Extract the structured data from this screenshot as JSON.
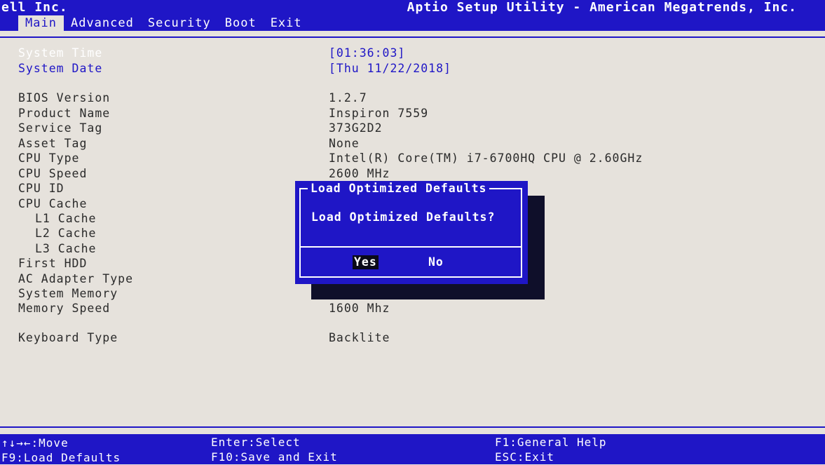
{
  "header": {
    "vendor": "ell Inc.",
    "utility": "Aptio Setup Utility - American Megatrends, Inc.",
    "tabs": [
      {
        "label": "Main",
        "active": true
      },
      {
        "label": "Advanced",
        "active": false
      },
      {
        "label": "Security",
        "active": false
      },
      {
        "label": "Boot",
        "active": false
      },
      {
        "label": "Exit",
        "active": false
      }
    ]
  },
  "main": {
    "system_time": {
      "label": "System Time",
      "value": "[01:36:03]"
    },
    "system_date": {
      "label": "System Date",
      "value": "[Thu 11/22/2018]"
    },
    "info": [
      {
        "label": "BIOS Version",
        "value": "1.2.7"
      },
      {
        "label": "Product Name",
        "value": "Inspiron 7559"
      },
      {
        "label": "Service Tag",
        "value": "373G2D2"
      },
      {
        "label": "Asset Tag",
        "value": "None"
      },
      {
        "label": "CPU Type",
        "value": "Intel(R) Core(TM) i7-6700HQ CPU @ 2.60GHz"
      },
      {
        "label": "CPU Speed",
        "value": "2600 MHz"
      },
      {
        "label": "CPU ID",
        "value": ""
      },
      {
        "label": "CPU Cache",
        "value": ""
      },
      {
        "label": "L1 Cache",
        "value": ""
      },
      {
        "label": "L2 Cache",
        "value": ""
      },
      {
        "label": "L3 Cache",
        "value": ""
      },
      {
        "label": "First HDD",
        "value": ""
      },
      {
        "label": "AC Adapter Type",
        "value": ""
      },
      {
        "label": "System Memory",
        "value": ""
      },
      {
        "label": "Memory Speed",
        "value": "1600 Mhz"
      }
    ],
    "keyboard": {
      "label": "Keyboard Type",
      "value": "Backlite"
    }
  },
  "dialog": {
    "title": "Load Optimized Defaults",
    "message": "Load Optimized Defaults?",
    "yes_label": "Yes",
    "no_label": "No",
    "selected": "Yes"
  },
  "footer": {
    "move": "↑↓→←:Move",
    "load_defaults": "F9:Load Defaults",
    "select": "Enter:Select",
    "save_exit": "F10:Save and Exit",
    "help": "F1:General Help",
    "exit": "ESC:Exit"
  },
  "colors": {
    "bios_blue": "#1f16c6",
    "background": "#e6e2dc",
    "text_white": "#ffffff",
    "text_dark": "#2a2a2a"
  }
}
